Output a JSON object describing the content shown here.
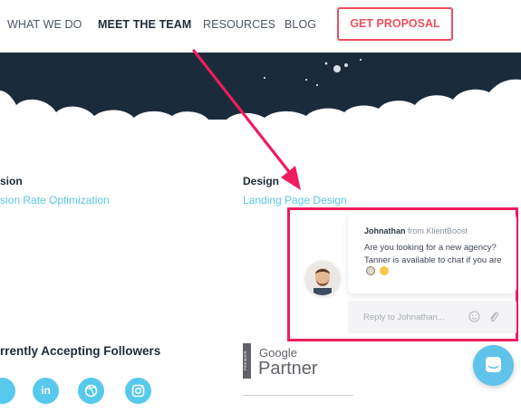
{
  "nav": {
    "items": [
      {
        "label": "WHAT WE DO"
      },
      {
        "label": "MEET THE TEAM"
      },
      {
        "label": "RESOURCES"
      },
      {
        "label": "BLOG"
      }
    ],
    "proposal_label": "GET PROPOSAL"
  },
  "columns": {
    "left": {
      "heading": "sion",
      "link": "sion Rate Optimization"
    },
    "right": {
      "heading": "Design",
      "link": "Landing Page Design"
    }
  },
  "followers": {
    "title": "rrently Accepting Followers",
    "icons": [
      {
        "icon": "social-icon"
      },
      {
        "icon": "linkedin-icon",
        "label": "in"
      },
      {
        "icon": "dribbble-icon"
      },
      {
        "icon": "instagram-icon"
      }
    ]
  },
  "partner": {
    "google": "Google",
    "partner": "Partner",
    "premier": "PREMIER"
  },
  "chat": {
    "sender": "Johnathan",
    "from_text": "from KlientBoost",
    "message": "Are you looking for a new agency? Tanner is available to chat if you are",
    "reply_placeholder": "Reply to Johnathan..."
  },
  "colors": {
    "accent": "#e8515e",
    "annotation": "#ee1d5e",
    "link": "#5ac7e6",
    "hero": "#1a2b3c",
    "launcher": "#5fc3ea"
  }
}
